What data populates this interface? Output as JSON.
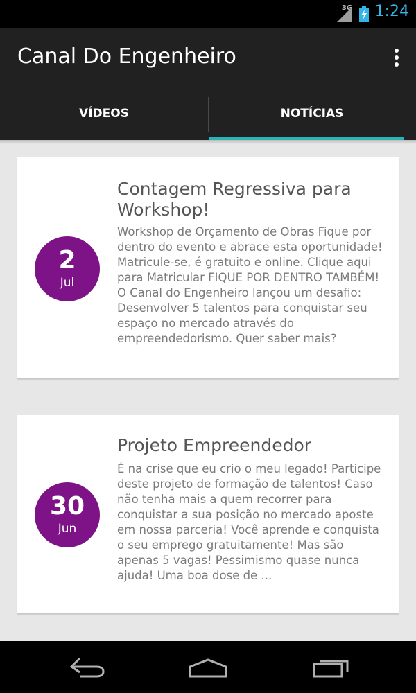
{
  "status_bar": {
    "network": "3G",
    "time": "1:24",
    "icons": [
      "signal-icon",
      "battery-charging-icon"
    ]
  },
  "action_bar": {
    "title": "Canal Do Engenheiro",
    "overflow_icon": "overflow-menu-icon"
  },
  "tabs": [
    {
      "label": "VÍDEOS",
      "selected": false
    },
    {
      "label": "NOTÍCIAS",
      "selected": true
    }
  ],
  "colors": {
    "accent": "#2ab3b5",
    "date_badge": "#7d1386",
    "action_bar": "#212121",
    "clock": "#33b5e5"
  },
  "news": [
    {
      "day": "2",
      "month": "Jul",
      "title": "Contagem Regressiva para Workshop!",
      "body": "Workshop de Orçamento de Obras Fique por dentro do evento e abrace esta oportunidade! Matricule-se, é gratuito e online. Clique aqui para Matricular FIQUE POR DENTRO TAMBÉM! O Canal do Engenheiro lançou um desafio: Desenvolver 5 talentos para conquistar seu espaço no mercado através do empreendedorismo. Quer saber mais?"
    },
    {
      "day": "30",
      "month": "Jun",
      "title": "Projeto Empreendedor",
      "body": "É na crise que eu crio o meu legado! Participe deste projeto de formação de talentos! Caso não tenha mais a quem recorrer para conquistar a sua posição no mercado aposte em nossa parceria! Você aprende e conquista o seu emprego gratuitamente! Mas são apenas 5 vagas! Pessimismo quase nunca ajuda! Uma boa dose de ..."
    }
  ],
  "nav_bar": {
    "icons": [
      "back-icon",
      "home-icon",
      "recent-apps-icon"
    ]
  }
}
